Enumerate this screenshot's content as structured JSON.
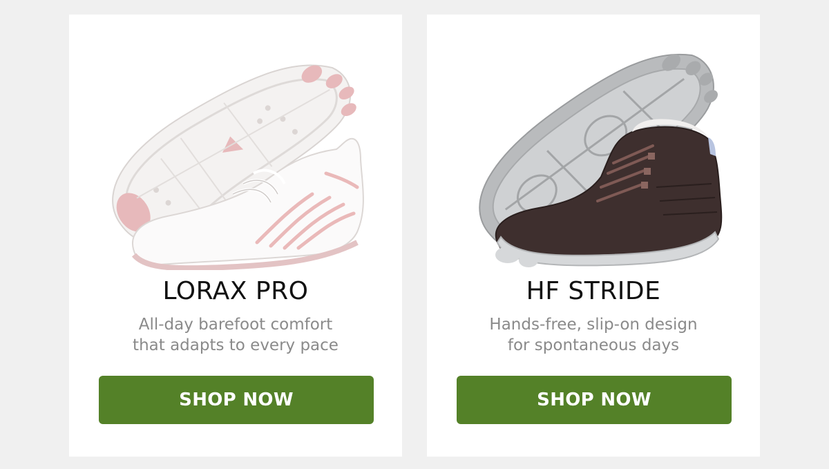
{
  "colors": {
    "page_background": "#f0f0f0",
    "card_background": "#ffffff",
    "button": "#548128",
    "button_text": "#ffffff",
    "title": "#111111",
    "description": "#8a8a8a"
  },
  "products": [
    {
      "name": "LORAX PRO",
      "description_line_1": "All-day barefoot comfort",
      "description_line_2": "that adapts to every pace",
      "button_label": "SHOP NOW",
      "image_icon": "white-pink-barefoot-sneaker-pair"
    },
    {
      "name": "HF STRIDE",
      "description_line_1": "Hands-free, slip-on design",
      "description_line_2": "for spontaneous days",
      "button_label": "SHOP NOW",
      "image_icon": "brown-barefoot-winter-boot-pair"
    }
  ]
}
